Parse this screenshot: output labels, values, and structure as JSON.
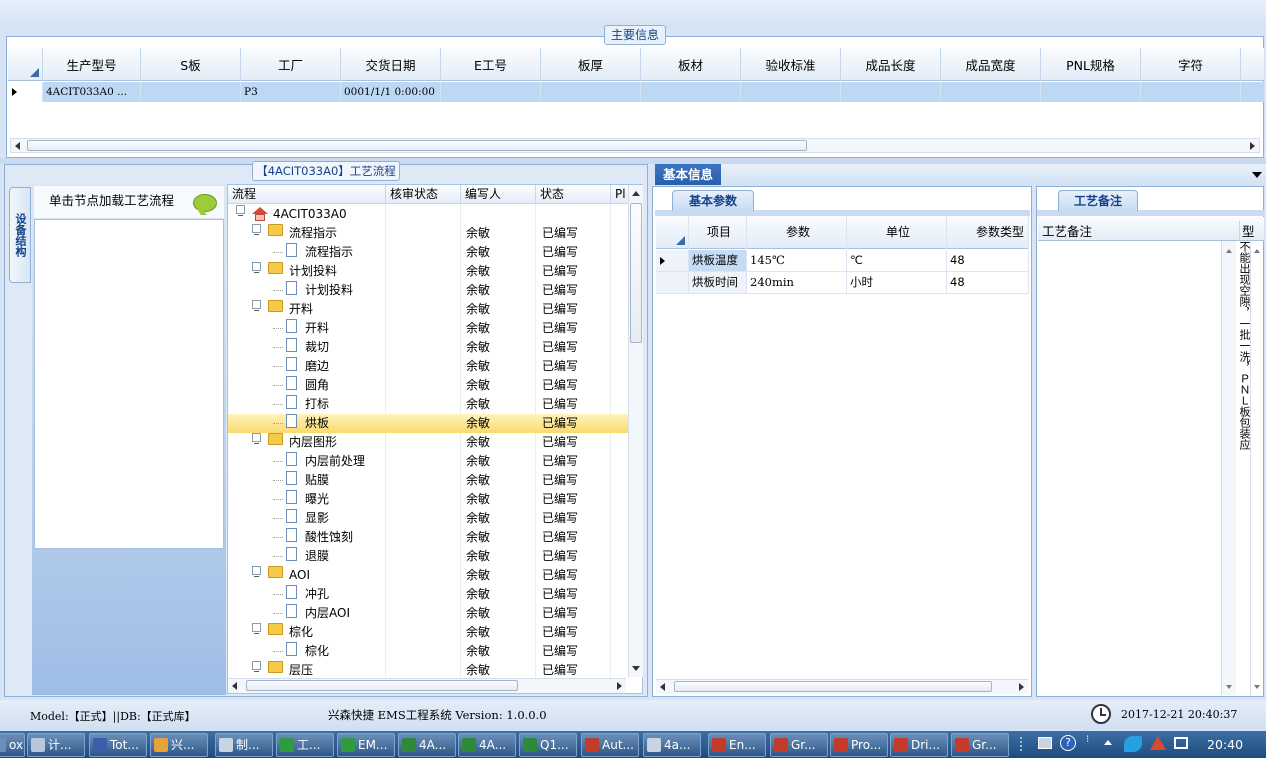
{
  "main_info": {
    "title": "主要信息",
    "columns": [
      "生产型号",
      "S板",
      "工厂",
      "交货日期",
      "E工号",
      "板厚",
      "板材",
      "验收标准",
      "成品长度",
      "成品宽度",
      "PNL规格",
      "字符"
    ],
    "row": [
      "4ACIT033A0 ...",
      "",
      "P3",
      "0001/1/1 0:00:00",
      "",
      "",
      "",
      "",
      "",
      "",
      "",
      ""
    ]
  },
  "process": {
    "title": "【4ACIT033A0】工艺流程",
    "vertical_tab": "设备结构",
    "nav_hint": "单击节点加载工艺流程",
    "columns": [
      "流程",
      "核审状态",
      "编写人",
      "状态",
      "Pl"
    ],
    "rows": [
      {
        "name": "4ACIT033A0",
        "level": 0,
        "kind": "root",
        "author": "",
        "status": ""
      },
      {
        "name": "流程指示",
        "level": 1,
        "kind": "folder",
        "author": "余敏",
        "status": "已编写"
      },
      {
        "name": "流程指示",
        "level": 2,
        "kind": "doc",
        "author": "余敏",
        "status": "已编写"
      },
      {
        "name": "计划投料",
        "level": 1,
        "kind": "folder",
        "author": "余敏",
        "status": "已编写"
      },
      {
        "name": "计划投料",
        "level": 2,
        "kind": "doc",
        "author": "余敏",
        "status": "已编写"
      },
      {
        "name": "开料",
        "level": 1,
        "kind": "folder",
        "author": "余敏",
        "status": "已编写"
      },
      {
        "name": "开料",
        "level": 2,
        "kind": "doc",
        "author": "余敏",
        "status": "已编写"
      },
      {
        "name": "裁切",
        "level": 2,
        "kind": "doc",
        "author": "余敏",
        "status": "已编写"
      },
      {
        "name": "磨边",
        "level": 2,
        "kind": "doc",
        "author": "余敏",
        "status": "已编写"
      },
      {
        "name": "圆角",
        "level": 2,
        "kind": "doc",
        "author": "余敏",
        "status": "已编写"
      },
      {
        "name": "打标",
        "level": 2,
        "kind": "doc",
        "author": "余敏",
        "status": "已编写"
      },
      {
        "name": "烘板",
        "level": 2,
        "kind": "doc",
        "author": "余敏",
        "status": "已编写",
        "selected": true
      },
      {
        "name": "内层图形",
        "level": 1,
        "kind": "folder",
        "author": "余敏",
        "status": "已编写"
      },
      {
        "name": "内层前处理",
        "level": 2,
        "kind": "doc",
        "author": "余敏",
        "status": "已编写"
      },
      {
        "name": "贴膜",
        "level": 2,
        "kind": "doc",
        "author": "余敏",
        "status": "已编写"
      },
      {
        "name": "曝光",
        "level": 2,
        "kind": "doc",
        "author": "余敏",
        "status": "已编写"
      },
      {
        "name": "显影",
        "level": 2,
        "kind": "doc",
        "author": "余敏",
        "status": "已编写"
      },
      {
        "name": "酸性蚀刻",
        "level": 2,
        "kind": "doc",
        "author": "余敏",
        "status": "已编写"
      },
      {
        "name": "退膜",
        "level": 2,
        "kind": "doc",
        "author": "余敏",
        "status": "已编写"
      },
      {
        "name": "AOI",
        "level": 1,
        "kind": "folder",
        "author": "余敏",
        "status": "已编写"
      },
      {
        "name": "冲孔",
        "level": 2,
        "kind": "doc",
        "author": "余敏",
        "status": "已编写"
      },
      {
        "name": "内层AOI",
        "level": 2,
        "kind": "doc",
        "author": "余敏",
        "status": "已编写"
      },
      {
        "name": "棕化",
        "level": 1,
        "kind": "folder",
        "author": "余敏",
        "status": "已编写"
      },
      {
        "name": "棕化",
        "level": 2,
        "kind": "doc",
        "author": "余敏",
        "status": "已编写"
      },
      {
        "name": "层压",
        "level": 1,
        "kind": "folder",
        "author": "余敏",
        "status": "已编写"
      }
    ]
  },
  "basic_info": {
    "tab": "基本信息",
    "param_tab": "基本参数",
    "columns": [
      "项目",
      "参数",
      "单位",
      "参数类型"
    ],
    "rows": [
      [
        "烘板温度",
        "145℃",
        "℃",
        "48"
      ],
      [
        "烘板时间",
        "240min",
        "小时",
        "48"
      ]
    ]
  },
  "notes": {
    "tab": "工艺备注",
    "header": "工艺备注",
    "col2": "型",
    "vertical_text": "不能出现空隙，一批一洗，ＰＮＬ板包装应以叠放方式"
  },
  "status": {
    "model": "Model:【正式】||DB:【正式库】",
    "app": "兴森快捷 EMS工程系统 Version: 1.0.0.0",
    "datetime": "2017-12-21 20:40:37"
  },
  "taskbar": {
    "items": [
      {
        "label": "ox...",
        "color": "#6b8fb8"
      },
      {
        "label": "计...",
        "color": "#b8c8dc"
      },
      {
        "label": "Tot...",
        "color": "#3a5fa8"
      },
      {
        "label": "兴...",
        "color": "#e7a33a"
      },
      {
        "label": "制...",
        "color": "#c8d4e4"
      },
      {
        "label": "工...",
        "color": "#2f9a3e"
      },
      {
        "label": "EM...",
        "color": "#2f9a3e"
      },
      {
        "label": "4A...",
        "color": "#2e8a3a"
      },
      {
        "label": "4A...",
        "color": "#2e8a3a"
      },
      {
        "label": "Q1...",
        "color": "#2e8a3a"
      },
      {
        "label": "Aut...",
        "color": "#c23b2b"
      },
      {
        "label": "4a...",
        "color": "#c8d4e4"
      },
      {
        "label": "En...",
        "color": "#c23b2b"
      },
      {
        "label": "Gr...",
        "color": "#c23b2b"
      },
      {
        "label": "Pro...",
        "color": "#c23b2b"
      },
      {
        "label": "Dri...",
        "color": "#c23b2b"
      },
      {
        "label": "Gr...",
        "color": "#c23b2b"
      }
    ],
    "clock": "20:40"
  }
}
